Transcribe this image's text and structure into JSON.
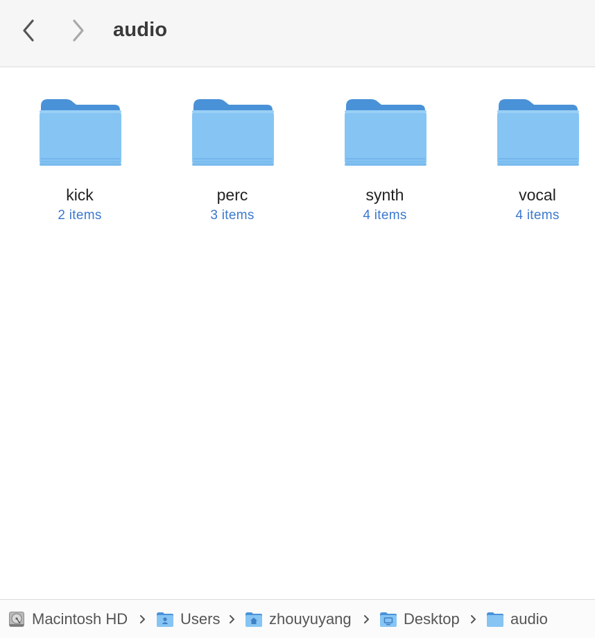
{
  "toolbar": {
    "back_icon": "chevron-left-icon",
    "forward_icon": "chevron-right-icon",
    "title": "audio"
  },
  "folders": [
    {
      "name": "kick",
      "count": "2 items",
      "icon": "folder-icon"
    },
    {
      "name": "perc",
      "count": "3 items",
      "icon": "folder-icon"
    },
    {
      "name": "synth",
      "count": "4 items",
      "icon": "folder-icon"
    },
    {
      "name": "vocal",
      "count": "4 items",
      "icon": "folder-icon"
    }
  ],
  "pathbar": {
    "items": [
      {
        "label": "Macintosh HD",
        "icon": "hard-drive-icon"
      },
      {
        "label": "Users",
        "icon": "users-folder-icon"
      },
      {
        "label": "zhouyuyang",
        "icon": "home-folder-icon"
      },
      {
        "label": "Desktop",
        "icon": "desktop-folder-icon"
      },
      {
        "label": "audio",
        "icon": "folder-icon"
      }
    ],
    "separator_icon": "chevron-right-icon"
  },
  "colors": {
    "folder_back": "#4a92d8",
    "folder_front": "#86c5f3",
    "count_text": "#3b78cf",
    "toolbar_bg": "#f6f6f6"
  }
}
